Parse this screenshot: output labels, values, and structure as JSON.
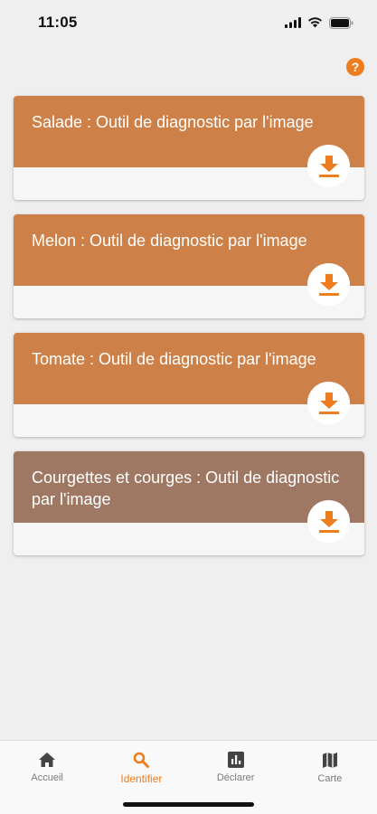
{
  "status": {
    "time": "11:05"
  },
  "help": {
    "label": "?"
  },
  "cards": [
    {
      "title": "Salade : Outil de diagnostic par l'image",
      "color": "#cd8148"
    },
    {
      "title": "Melon : Outil de diagnostic par l'image",
      "color": "#cd8148"
    },
    {
      "title": "Tomate : Outil de diagnostic par l'image",
      "color": "#cd8148"
    },
    {
      "title": "Courgettes et courges : Outil de diagnostic par l'image",
      "color": "#9f7863"
    }
  ],
  "tabs": [
    {
      "label": "Accueil",
      "icon": "home-icon"
    },
    {
      "label": "Identifier",
      "icon": "search-icon",
      "active": true
    },
    {
      "label": "Déclarer",
      "icon": "chart-icon"
    },
    {
      "label": "Carte",
      "icon": "map-icon"
    }
  ],
  "colors": {
    "accent": "#ee7d1f",
    "card_header": "#cd8148",
    "card_header_alt": "#9f7863"
  }
}
